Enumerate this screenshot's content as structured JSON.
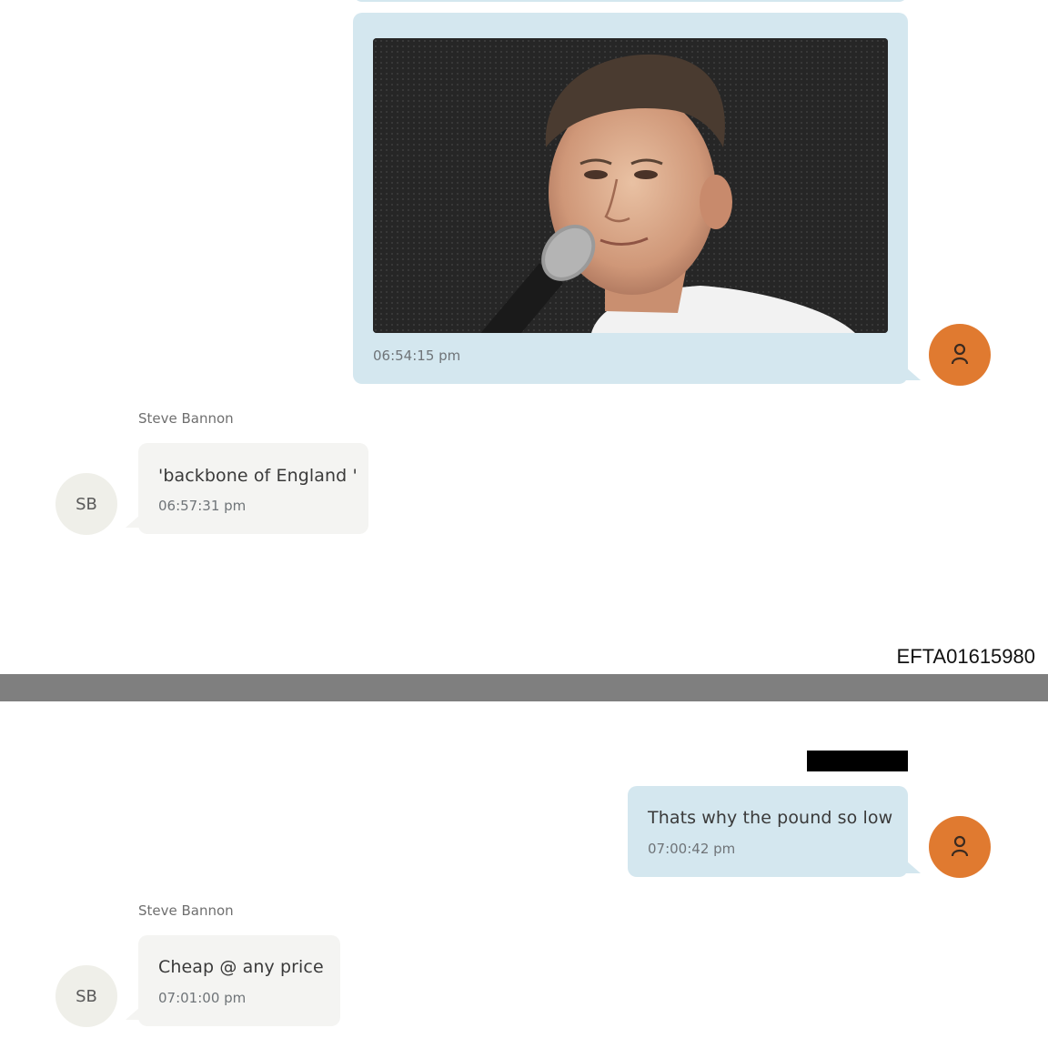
{
  "messages": [
    {
      "id": "m1",
      "direction": "outgoing",
      "type": "image",
      "time": "06:54:15 pm"
    },
    {
      "id": "m2",
      "direction": "incoming",
      "sender": "Steve Bannon",
      "avatar_initials": "SB",
      "text": "'backbone of England '",
      "time": "06:57:31 pm"
    },
    {
      "id": "m3",
      "direction": "outgoing",
      "text": "Thats why the pound so low",
      "time": "07:00:42 pm"
    },
    {
      "id": "m4",
      "direction": "incoming",
      "sender": "Steve Bannon",
      "avatar_initials": "SB",
      "text": "Cheap @ any price",
      "time": "07:01:00 pm"
    }
  ],
  "document": {
    "page_id": "EFTA01615980"
  },
  "colors": {
    "outgoing_bubble": "#d4e7ef",
    "incoming_bubble": "#f4f4f2",
    "user_avatar": "#e07a30",
    "divider": "#7f7f7f"
  },
  "icons": {
    "user_avatar": "person-icon"
  }
}
